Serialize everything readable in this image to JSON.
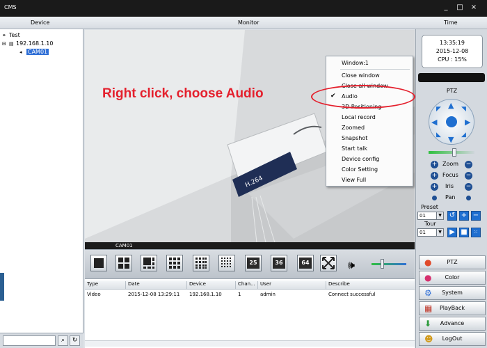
{
  "window": {
    "title": "CMS",
    "minimize": "_",
    "maximize": "□",
    "close": "×"
  },
  "headers": {
    "device": "Device",
    "monitor": "Monitor",
    "time": "Time"
  },
  "device_tree": {
    "root": "Test",
    "device": "192.168.1.10",
    "camera": "CAM01"
  },
  "video": {
    "camera_label": "CAM01",
    "annotation": "Right click, choose Audio"
  },
  "context_menu": {
    "header": "Window:1",
    "items": [
      "Close window",
      "Close all window",
      "Audio",
      "3D Positioning",
      "Local record",
      "Zoomed",
      "Snapshot",
      "Start talk",
      "Device config",
      "Color Setting",
      "View Full"
    ],
    "checked": "Audio"
  },
  "toolbar": {
    "split_labels": [
      "25",
      "36",
      "64"
    ],
    "volume_icon": "speaker-icon"
  },
  "log": {
    "columns": [
      "Type",
      "Date",
      "Device",
      "Chan...",
      "User",
      "Describe"
    ],
    "rows": [
      {
        "type": "Video",
        "date": "2015-12-08 13:29:11",
        "device": "192.168.1.10",
        "chan": "1",
        "user": "admin",
        "describe": "Connect successful"
      }
    ]
  },
  "status": {
    "time": "13:35:19",
    "date": "2015-12-08",
    "cpu": "CPU : 15%"
  },
  "ptz": {
    "title": "PTZ",
    "controls": [
      "Zoom",
      "Focus",
      "Iris",
      "Pan"
    ],
    "preset_label": "Preset",
    "preset_value": "01",
    "tour_label": "Tour",
    "tour_value": "01"
  },
  "nav": [
    "PTZ",
    "Color",
    "System",
    "PlayBack",
    "Advance",
    "LogOut"
  ]
}
